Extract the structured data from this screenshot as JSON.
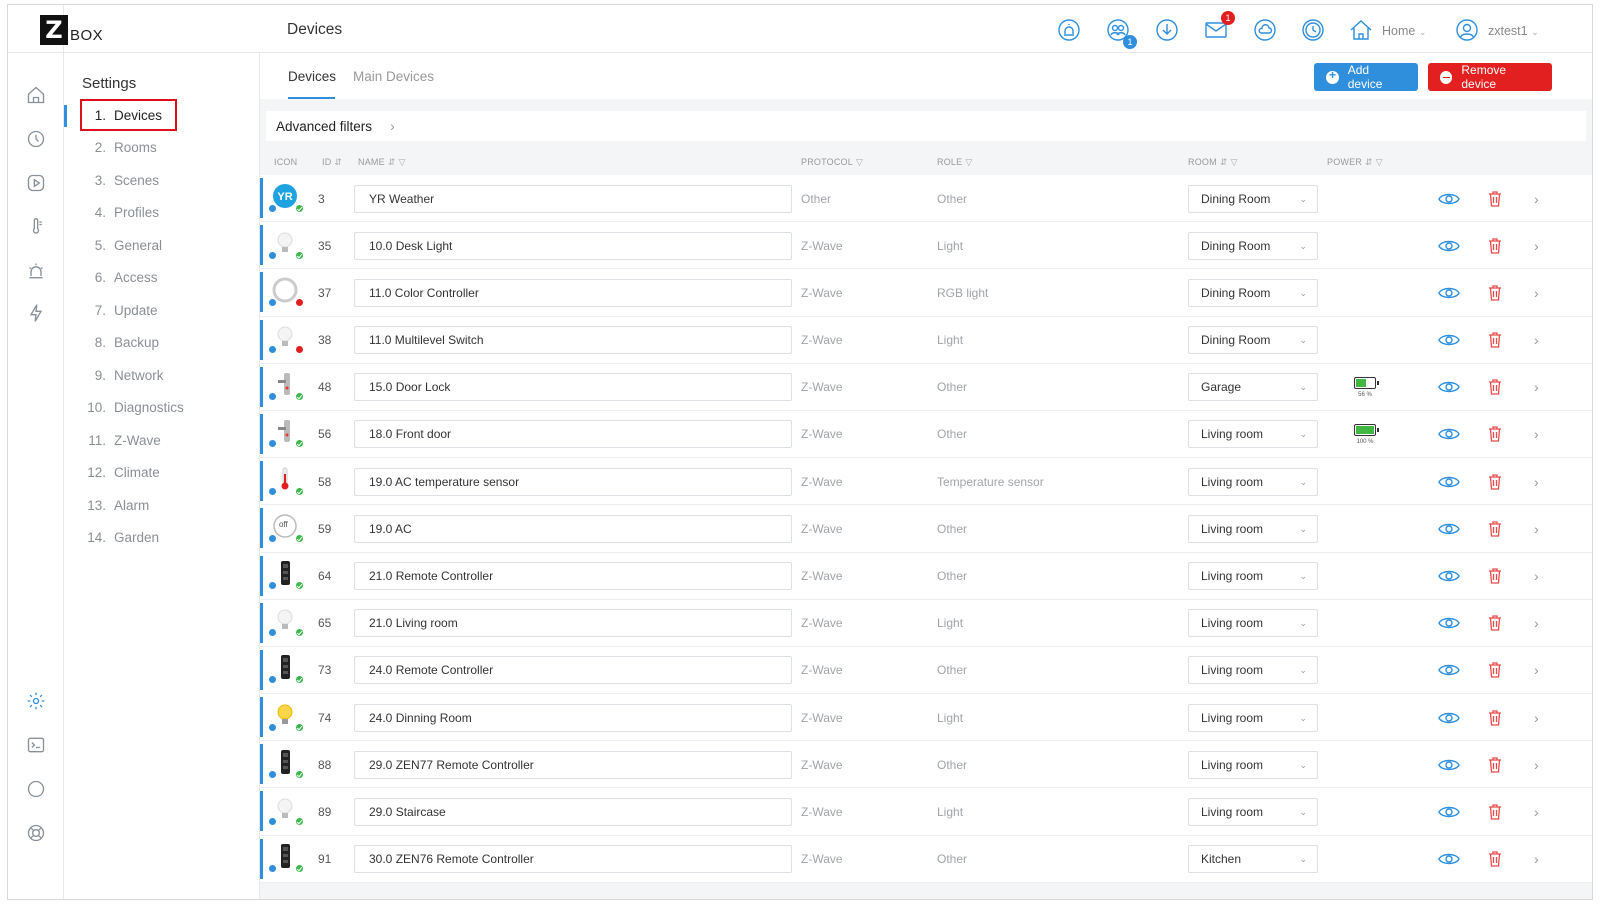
{
  "app": {
    "logo_letter": "Z",
    "logo_text": "BOX"
  },
  "header": {
    "title": "Devices",
    "messages_badge": "1",
    "users_badge": "1",
    "home_label": "Home",
    "user_label": "zxtest1"
  },
  "settings": {
    "title": "Settings",
    "items": [
      {
        "num": "1.",
        "label": "Devices"
      },
      {
        "num": "2.",
        "label": "Rooms"
      },
      {
        "num": "3.",
        "label": "Scenes"
      },
      {
        "num": "4.",
        "label": "Profiles"
      },
      {
        "num": "5.",
        "label": "General"
      },
      {
        "num": "6.",
        "label": "Access"
      },
      {
        "num": "7.",
        "label": "Update"
      },
      {
        "num": "8.",
        "label": "Backup"
      },
      {
        "num": "9.",
        "label": "Network"
      },
      {
        "num": "10.",
        "label": "Diagnostics"
      },
      {
        "num": "11.",
        "label": "Z-Wave"
      },
      {
        "num": "12.",
        "label": "Climate"
      },
      {
        "num": "13.",
        "label": "Alarm"
      },
      {
        "num": "14.",
        "label": "Garden"
      }
    ]
  },
  "tabs": [
    {
      "label": "Devices"
    },
    {
      "label": "Main Devices"
    }
  ],
  "actions": {
    "add": "Add device",
    "remove": "Remove device"
  },
  "filters": {
    "label": "Advanced filters"
  },
  "columns": {
    "icon": "ICON",
    "id": "ID",
    "name": "NAME",
    "protocol": "PROTOCOL",
    "role": "ROLE",
    "room": "ROOM",
    "power": "POWER"
  },
  "colors": {
    "accent": "#2f8fdd",
    "danger": "#e32020",
    "ok": "#3bb84a"
  },
  "devices": [
    {
      "icon": "yr-weather-icon",
      "id": "3",
      "name": "YR Weather",
      "protocol": "Other",
      "role": "Other",
      "room": "Dining Room"
    },
    {
      "icon": "bulb-icon",
      "id": "35",
      "name": "10.0 Desk Light",
      "protocol": "Z-Wave",
      "role": "Light",
      "room": "Dining Room"
    },
    {
      "icon": "color-controller-icon",
      "id": "37",
      "name": "11.0 Color Controller",
      "protocol": "Z-Wave",
      "role": "RGB light",
      "room": "Dining Room"
    },
    {
      "icon": "bulb-icon",
      "id": "38",
      "name": "11.0 Multilevel Switch",
      "protocol": "Z-Wave",
      "role": "Light",
      "room": "Dining Room"
    },
    {
      "icon": "door-lock-icon",
      "id": "48",
      "name": "15.0 Door Lock",
      "protocol": "Z-Wave",
      "role": "Other",
      "room": "Garage",
      "power": "56 %",
      "power_level": 0.56
    },
    {
      "icon": "door-lock-icon",
      "id": "56",
      "name": "18.0 Front door",
      "protocol": "Z-Wave",
      "role": "Other",
      "room": "Living room",
      "power": "100 %",
      "power_level": 1.0
    },
    {
      "icon": "thermometer-icon",
      "id": "58",
      "name": "19.0 AC temperature sensor",
      "protocol": "Z-Wave",
      "role": "Temperature sensor",
      "room": "Living room"
    },
    {
      "icon": "ac-off-icon",
      "id": "59",
      "name": "19.0 AC",
      "protocol": "Z-Wave",
      "role": "Other",
      "room": "Living room",
      "icon_text": "off"
    },
    {
      "icon": "remote-icon",
      "id": "64",
      "name": "21.0 Remote Controller",
      "protocol": "Z-Wave",
      "role": "Other",
      "room": "Living room"
    },
    {
      "icon": "bulb-icon",
      "id": "65",
      "name": "21.0 Living room",
      "protocol": "Z-Wave",
      "role": "Light",
      "room": "Living room"
    },
    {
      "icon": "remote-icon",
      "id": "73",
      "name": "24.0 Remote Controller",
      "protocol": "Z-Wave",
      "role": "Other",
      "room": "Living room"
    },
    {
      "icon": "bulb-on-icon",
      "id": "74",
      "name": "24.0 Dinning Room",
      "protocol": "Z-Wave",
      "role": "Light",
      "room": "Living room"
    },
    {
      "icon": "remote-icon",
      "id": "88",
      "name": "29.0 ZEN77 Remote Controller",
      "protocol": "Z-Wave",
      "role": "Other",
      "room": "Living room"
    },
    {
      "icon": "bulb-icon",
      "id": "89",
      "name": "29.0 Staircase",
      "protocol": "Z-Wave",
      "role": "Light",
      "room": "Living room"
    },
    {
      "icon": "remote-icon",
      "id": "91",
      "name": "30.0 ZEN76 Remote Controller",
      "protocol": "Z-Wave",
      "role": "Other",
      "room": "Kitchen"
    }
  ]
}
